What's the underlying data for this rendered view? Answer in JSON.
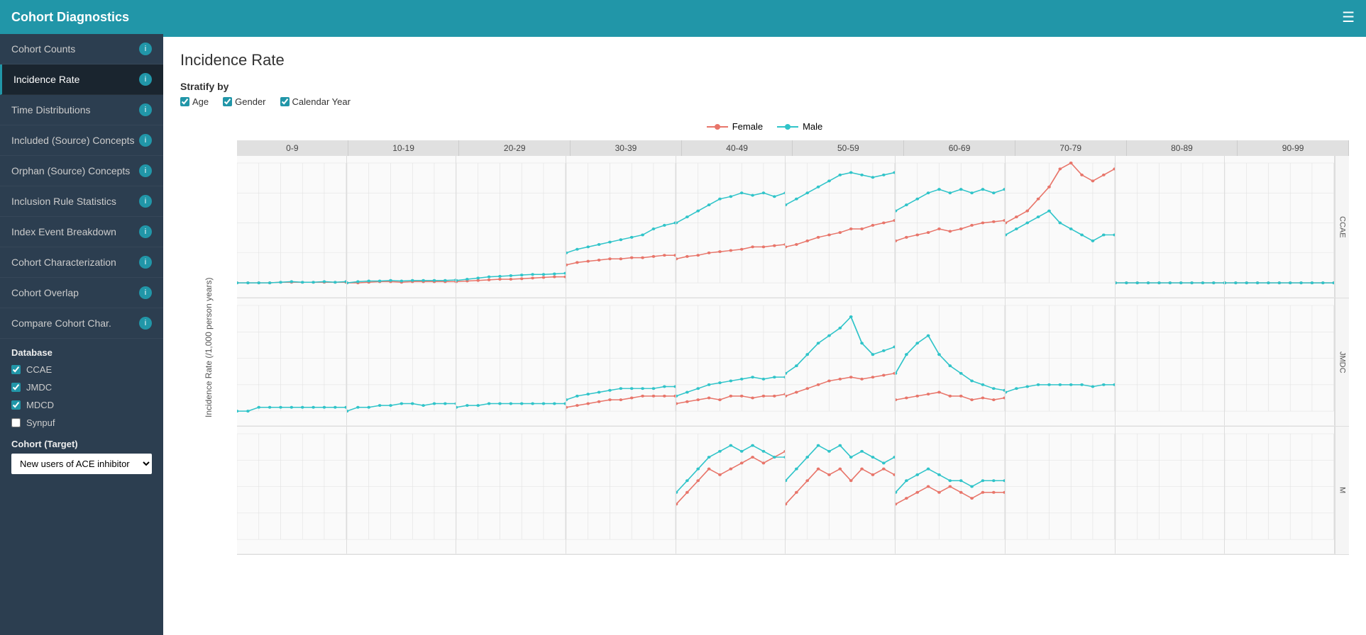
{
  "app": {
    "title": "Cohort Diagnostics"
  },
  "sidebar": {
    "items": [
      {
        "label": "Cohort Counts",
        "active": false
      },
      {
        "label": "Incidence Rate",
        "active": true
      },
      {
        "label": "Time Distributions",
        "active": false
      },
      {
        "label": "Included (Source) Concepts",
        "active": false
      },
      {
        "label": "Orphan (Source) Concepts",
        "active": false
      },
      {
        "label": "Inclusion Rule Statistics",
        "active": false
      },
      {
        "label": "Index Event Breakdown",
        "active": false
      },
      {
        "label": "Cohort Characterization",
        "active": false
      },
      {
        "label": "Cohort Overlap",
        "active": false
      },
      {
        "label": "Compare Cohort Char.",
        "active": false
      }
    ],
    "database_section": "Database",
    "databases": [
      {
        "label": "CCAE",
        "checked": true
      },
      {
        "label": "JMDC",
        "checked": true
      },
      {
        "label": "MDCD",
        "checked": true
      },
      {
        "label": "Synpuf",
        "checked": false
      }
    ],
    "cohort_target_label": "Cohort (Target)",
    "cohort_select_value": "New users of ACE inhibitor",
    "cohort_options": [
      "New users of ACE inhibitor"
    ]
  },
  "main": {
    "page_title": "Incidence Rate",
    "stratify_label": "Stratify by",
    "stratify_options": [
      {
        "label": "Age",
        "checked": true
      },
      {
        "label": "Gender",
        "checked": true
      },
      {
        "label": "Calendar Year",
        "checked": true
      }
    ],
    "legend": {
      "female": "Female",
      "male": "Male"
    },
    "age_groups": [
      "0-9",
      "10-19",
      "20-29",
      "30-39",
      "40-49",
      "50-59",
      "60-69",
      "70-79",
      "80-89",
      "90-99"
    ],
    "db_rows": [
      {
        "label": "CCAE"
      },
      {
        "label": "JMDC"
      },
      {
        "label": "MDCD"
      }
    ],
    "y_axis_label": "Incidence Rate (/1,000 person years)"
  },
  "hamburger_icon": "☰"
}
